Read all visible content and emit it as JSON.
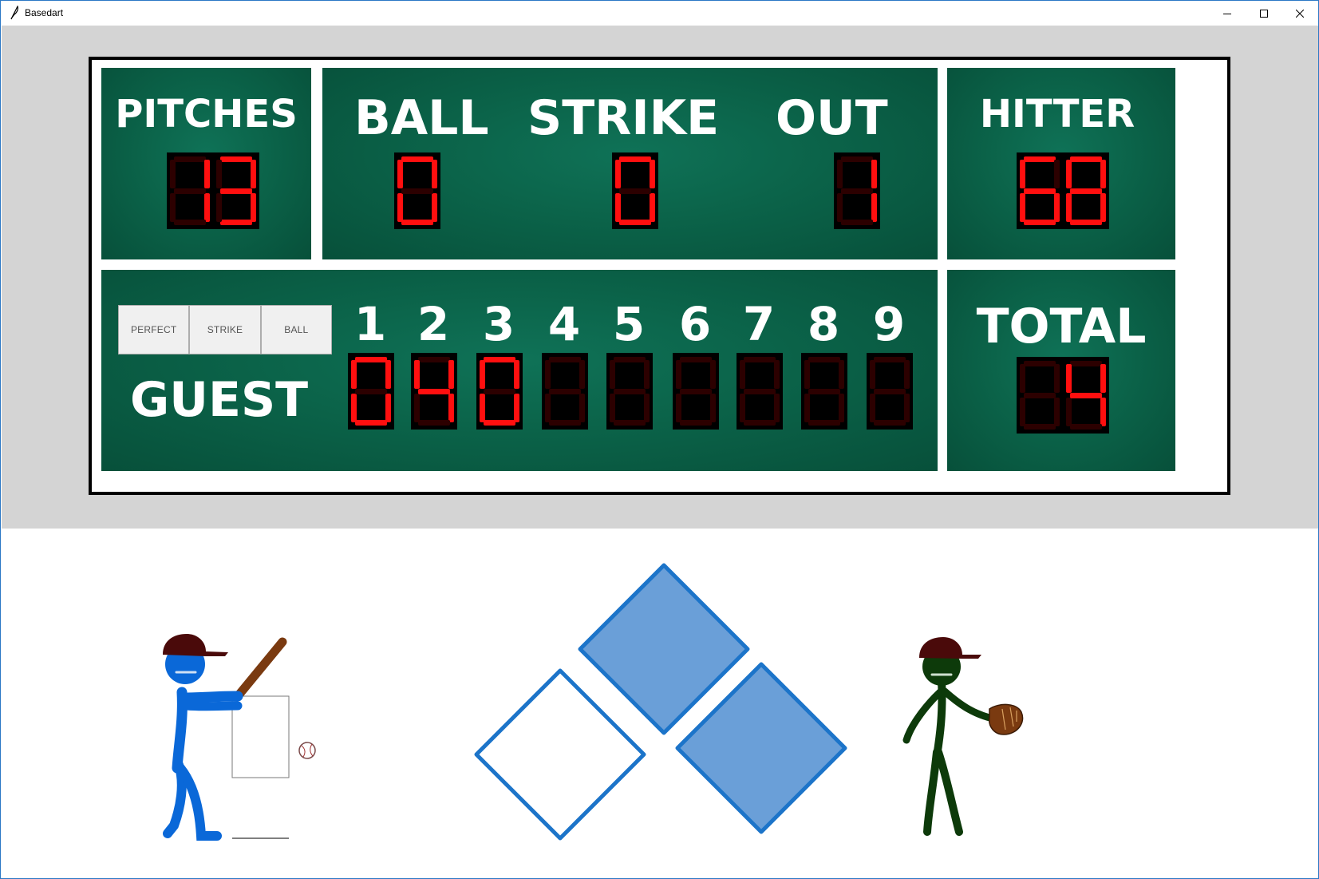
{
  "window": {
    "title": "Basedart",
    "minimize_icon": "minimize-icon",
    "maximize_icon": "maximize-icon",
    "close_icon": "close-icon"
  },
  "scoreboard": {
    "pitches": {
      "label": "PITCHES",
      "value": "13"
    },
    "ball": {
      "label": "BALL",
      "value": "0"
    },
    "strike": {
      "label": "STRIKE",
      "value": "0"
    },
    "out": {
      "label": "OUT",
      "value": "1"
    },
    "hitter": {
      "label": "HITTER",
      "value": "68"
    },
    "team": {
      "label": "GUEST"
    },
    "innings": [
      {
        "label": "1",
        "value": "0"
      },
      {
        "label": "2",
        "value": "4"
      },
      {
        "label": "3",
        "value": "0"
      },
      {
        "label": "4",
        "value": ""
      },
      {
        "label": "5",
        "value": ""
      },
      {
        "label": "6",
        "value": ""
      },
      {
        "label": "7",
        "value": ""
      },
      {
        "label": "8",
        "value": ""
      },
      {
        "label": "9",
        "value": ""
      }
    ],
    "total": {
      "label": "TOTAL",
      "value": "4"
    },
    "buttons": [
      "PERFECT",
      "STRIKE",
      "BALL"
    ]
  },
  "field": {
    "bases": [
      {
        "name": "second-base",
        "occupied": true
      },
      {
        "name": "third-base",
        "occupied": false
      },
      {
        "name": "first-base",
        "occupied": true
      }
    ]
  },
  "colors": {
    "board_green": "#0b6349",
    "led_on": "#ff0f0f",
    "led_off": "#2c0000",
    "batter": "#0a68d8",
    "pitcher": "#0d3a0a",
    "base_fill": "#6a9fd8",
    "base_stroke": "#1c74c9",
    "cap": "#4a0a0a",
    "bat": "#7a3a10"
  }
}
